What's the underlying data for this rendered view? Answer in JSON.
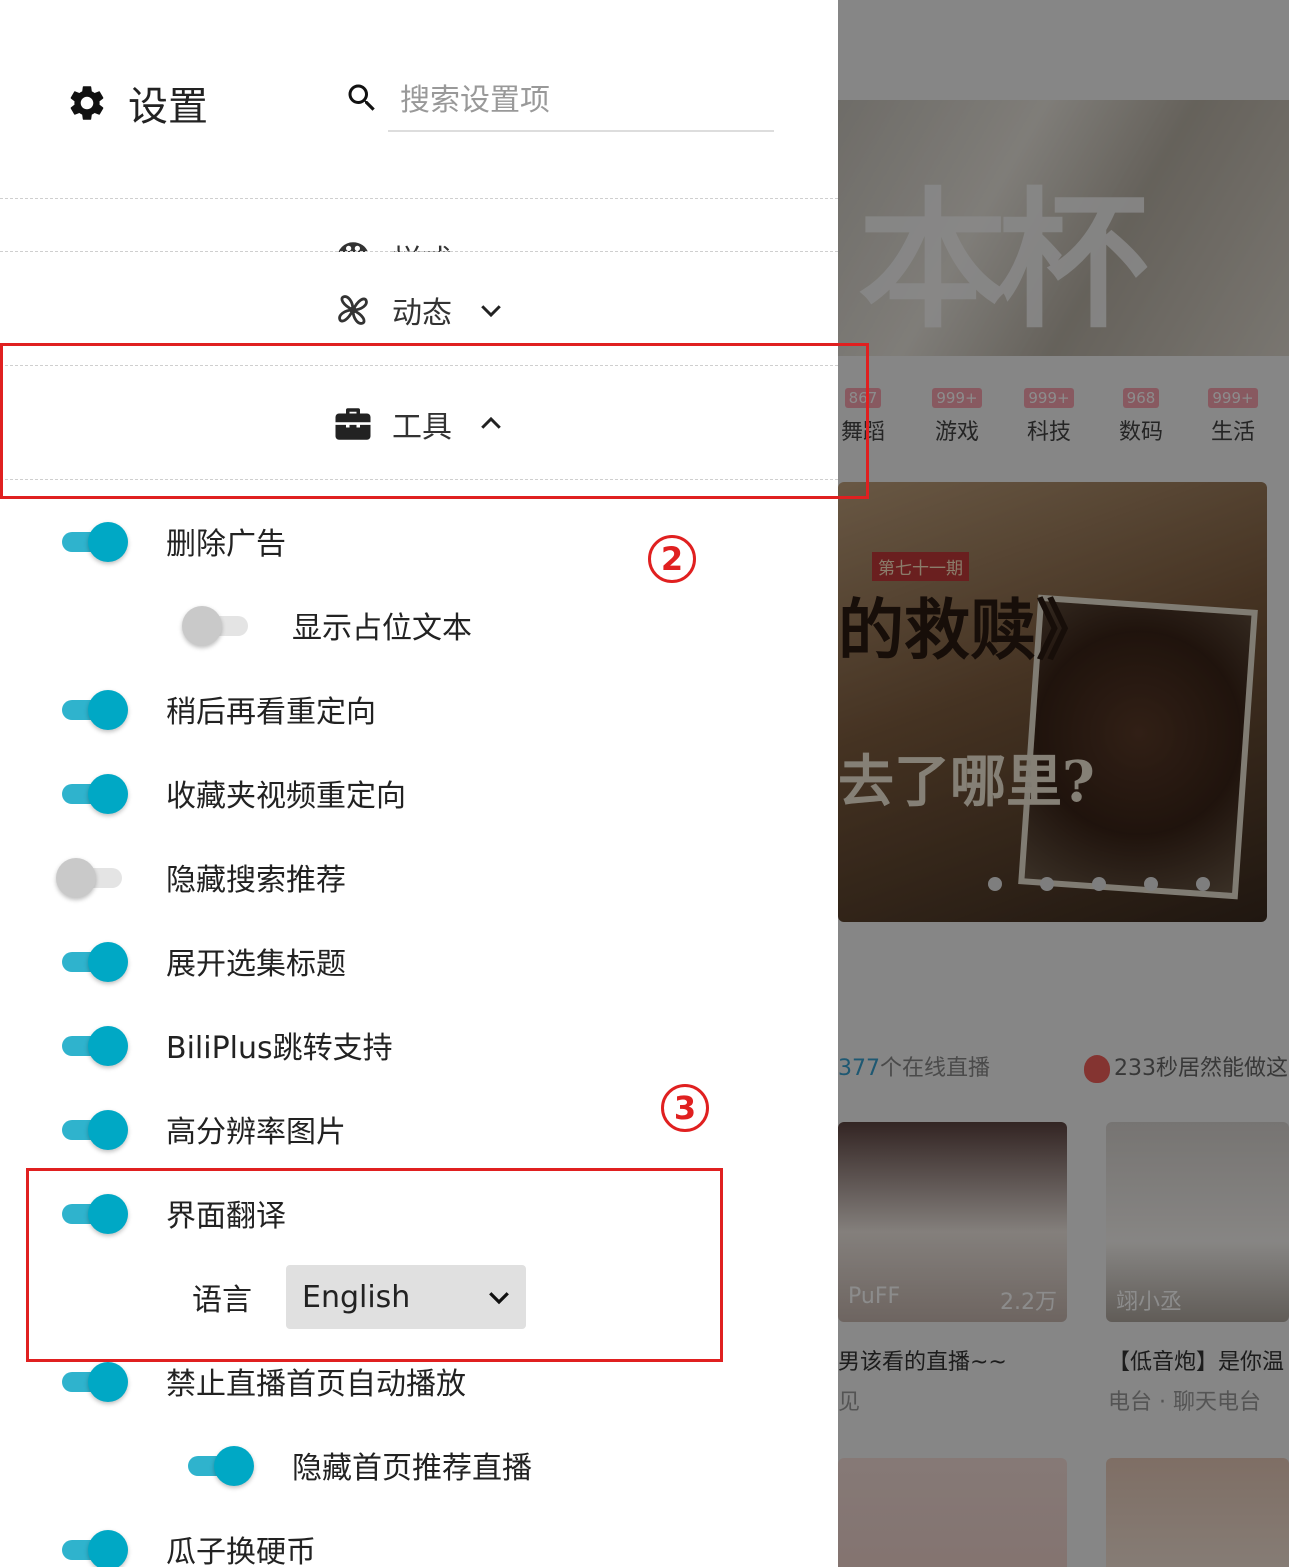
{
  "settings": {
    "title": "设置",
    "search_placeholder": "搜索设置项",
    "sections": {
      "style_label": "样式",
      "dynamic_label": "动态",
      "tools_label": "工具"
    },
    "items": [
      {
        "label": "删除广告",
        "on": true,
        "indent": 0
      },
      {
        "label": "显示占位文本",
        "on": false,
        "indent": 1
      },
      {
        "label": "稍后再看重定向",
        "on": true,
        "indent": 0
      },
      {
        "label": "收藏夹视频重定向",
        "on": true,
        "indent": 0
      },
      {
        "label": "隐藏搜索推荐",
        "on": false,
        "indent": 0
      },
      {
        "label": "展开选集标题",
        "on": true,
        "indent": 0
      },
      {
        "label": "BiliPlus跳转支持",
        "on": true,
        "indent": 0
      },
      {
        "label": "高分辨率图片",
        "on": true,
        "indent": 0
      },
      {
        "label": "界面翻译",
        "on": true,
        "indent": 0
      },
      {
        "label": "禁止直播首页自动播放",
        "on": true,
        "indent": 0
      },
      {
        "label": "隐藏首页推荐直播",
        "on": true,
        "indent": 1
      },
      {
        "label": "瓜子换硬币",
        "on": true,
        "indent": 0
      }
    ],
    "language": {
      "label": "语言",
      "selected": "English"
    }
  },
  "annotations": {
    "marker_2": "2",
    "marker_3": "3",
    "color": "#e02020"
  },
  "background": {
    "banner_text": "本杯",
    "tabs": [
      {
        "count": "867",
        "name": "舞蹈"
      },
      {
        "count": "999+",
        "name": "游戏"
      },
      {
        "count": "999+",
        "name": "科技"
      },
      {
        "count": "968",
        "name": "数码"
      },
      {
        "count": "999+",
        "name": "生活"
      }
    ],
    "poster_episode": "第七十一期",
    "poster_line1": "的救赎》",
    "poster_line2": "去了哪里?",
    "live_count": "377",
    "live_suffix": "个在线直播",
    "hot_text": "233秒居然能做这",
    "card1_name": "PuFF",
    "card1_views": "2.2万",
    "card2_name": "翊小丞",
    "card1_caption": "男该看的直播~~",
    "card1_sub": "见",
    "card2_caption": "【低音炮】是你温",
    "card2_sub": "电台 · 聊天电台"
  },
  "colors": {
    "accent": "#00a8c5",
    "toggle_track_on": "#2fb3cd",
    "toggle_off": "#c9c9c9"
  }
}
